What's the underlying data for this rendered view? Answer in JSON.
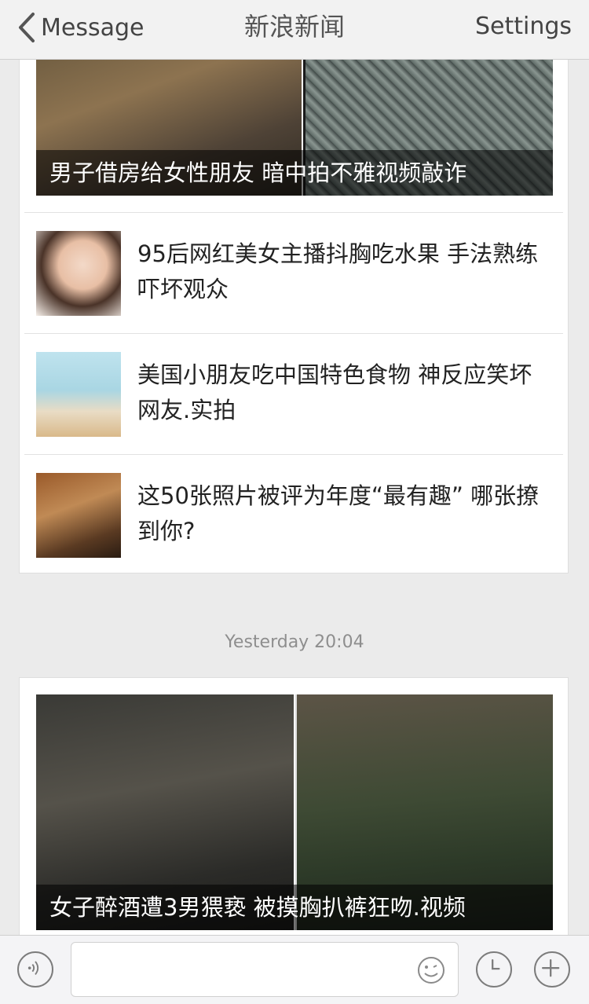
{
  "nav": {
    "back_label": "Message",
    "title": "新浪新闻",
    "settings_label": "Settings"
  },
  "card1": {
    "hero_caption": "男子借房给女性朋友 暗中拍不雅视频敲诈",
    "items": [
      {
        "title": "95后网红美女主播抖胸吃水果 手法熟练吓坏观众"
      },
      {
        "title": "美国小朋友吃中国特色食物 神反应笑坏网友.实拍"
      },
      {
        "title": "这50张照片被评为年度“最有趣” 哪张撩到你?"
      }
    ]
  },
  "timestamp": "Yesterday 20:04",
  "card2": {
    "hero_caption": "女子醉酒遭3男猥亵 被摸胸扒裤狂吻.视频"
  },
  "toolbar": {
    "voice_icon": "voice-icon",
    "emoji_icon": "emoji-icon",
    "clock_icon": "clock-icon",
    "plus_icon": "plus-icon"
  }
}
